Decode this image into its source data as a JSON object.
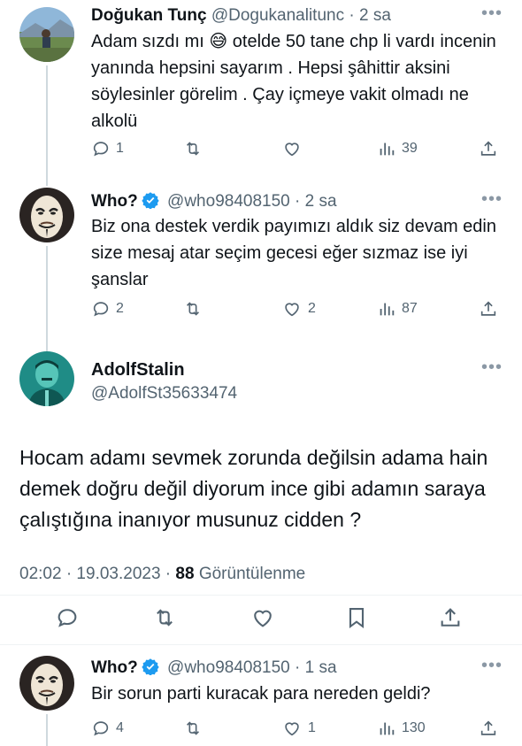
{
  "tweets": [
    {
      "name": "Doğukan Tunç",
      "handle": "@Dogukanalitunc",
      "time": "· 2 sa",
      "text_part1": "Adam sızdı mı ",
      "emoji": "😅",
      "text_part2": " otelde 50 tane chp li vardı incenin yanında hepsini  sayarım . Hepsi şâhittir aksini söylesinler görelim . Çay içmeye vakit olmadı ne alkolü",
      "replies": "1",
      "retweets": "",
      "likes": "",
      "views": "39"
    },
    {
      "name": "Who?",
      "handle": "@who98408150",
      "time": "· 2 sa",
      "text": "Biz ona destek verdik payımızı aldık siz devam edin size mesaj atar seçim gecesi eğer sızmaz ise iyi şanslar",
      "replies": "2",
      "retweets": "",
      "likes": "2",
      "views": "87"
    }
  ],
  "main": {
    "name": "AdolfStalin",
    "handle": "@AdolfSt35633474",
    "text": "Hocam adamı sevmek zorunda değilsin adama hain demek doğru değil diyorum ince gibi adamın saraya çalıştığına inanıyor musunuz cidden ?",
    "time": "02:02 · 19.03.2023 · ",
    "views": "88",
    "views_label": " Görüntülenme"
  },
  "reply": {
    "name": "Who?",
    "handle": "@who98408150",
    "time": "· 1 sa",
    "text": "Bir sorun parti kuracak para nereden geldi?",
    "replies": "4",
    "retweets": "",
    "likes": "1",
    "views": "130"
  },
  "colors": {
    "text": "#0f1419",
    "secondary": "#536471",
    "verified": "#1d9bf0",
    "divider": "#eff3f4",
    "thread_line": "#cfd9de"
  },
  "icons": [
    "reply-icon",
    "retweet-icon",
    "like-icon",
    "views-icon",
    "share-icon",
    "bookmark-icon",
    "more-icon",
    "verified-icon"
  ]
}
